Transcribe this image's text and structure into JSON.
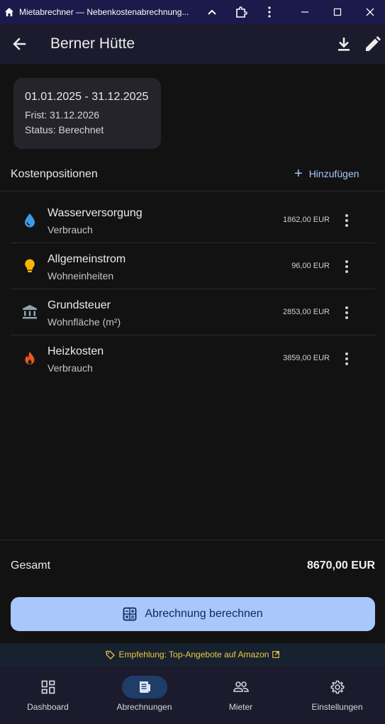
{
  "window": {
    "title": "Mietabrechner — Nebenkostenabrechnung..."
  },
  "appbar": {
    "title": "Berner Hütte"
  },
  "info": {
    "period": "01.01.2025 - 31.12.2025",
    "deadline": "Frist: 31.12.2026",
    "status": "Status: Berechnet"
  },
  "section": {
    "title": "Kostenpositionen",
    "add_label": "Hinzufügen"
  },
  "items": [
    {
      "name": "Wasserversorgung",
      "key": "Verbrauch",
      "amount": "1862,00 EUR",
      "icon": "water-drop-icon",
      "color": "#4aa8f0"
    },
    {
      "name": "Allgemeinstrom",
      "key": "Wohneinheiten",
      "amount": "96,00 EUR",
      "icon": "lightbulb-icon",
      "color": "#f5b800"
    },
    {
      "name": "Grundsteuer",
      "key": "Wohnfläche (m²)",
      "amount": "2853,00 EUR",
      "icon": "bank-icon",
      "color": "#8fa4ad"
    },
    {
      "name": "Heizkosten",
      "key": "Verbrauch",
      "amount": "3859,00 EUR",
      "icon": "fire-icon",
      "color": "#e85a1e"
    }
  ],
  "total": {
    "label": "Gesamt",
    "value": "8670,00 EUR"
  },
  "actions": {
    "calculate_label": "Abrechnung berechnen"
  },
  "promo": {
    "text": "Empfehlung: Top-Angebote auf Amazon"
  },
  "nav": [
    {
      "label": "Dashboard",
      "icon": "dashboard-icon",
      "active": false
    },
    {
      "label": "Abrechnungen",
      "icon": "receipt-icon",
      "active": true
    },
    {
      "label": "Mieter",
      "icon": "people-icon",
      "active": false
    },
    {
      "label": "Einstellungen",
      "icon": "gear-icon",
      "active": false
    }
  ],
  "colors": {
    "accent": "#a8c7fa",
    "promo": "#f4c542",
    "background": "#121212"
  }
}
